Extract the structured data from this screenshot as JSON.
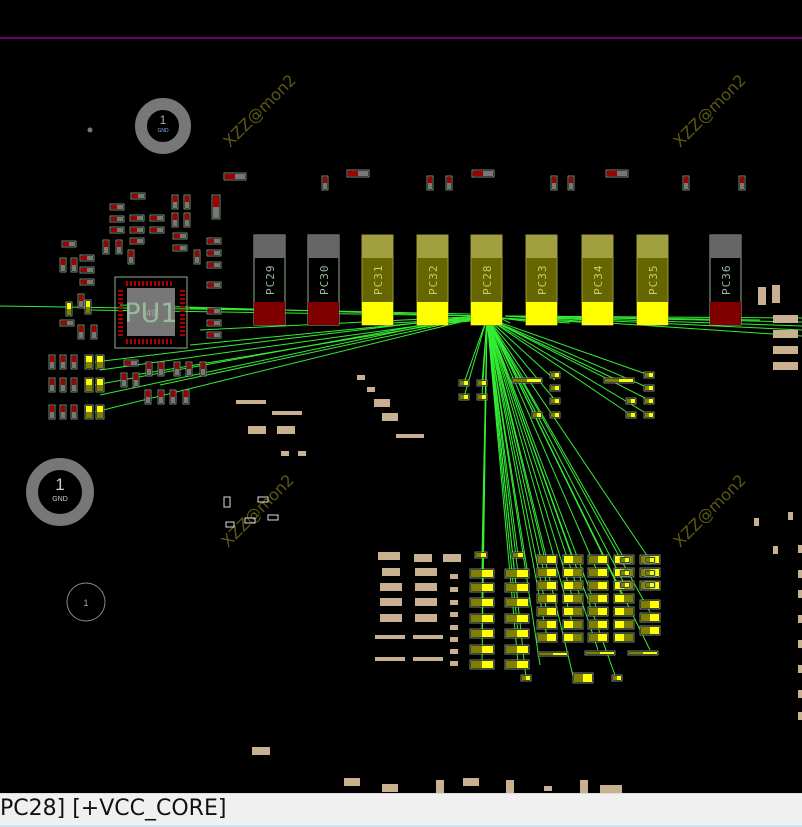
{
  "board": {
    "watermark": "XZZ@mon2",
    "ic": {
      "ref": "PU1",
      "sub": "49"
    },
    "mounting_holes": [
      {
        "pin": "1",
        "net": "GND"
      },
      {
        "pin": "1",
        "net": "GND"
      },
      {
        "pin": "1"
      }
    ],
    "capacitors": [
      {
        "ref": "PC29",
        "state": "unselected"
      },
      {
        "ref": "PC30",
        "state": "unselected"
      },
      {
        "ref": "PC31",
        "state": "highlighted"
      },
      {
        "ref": "PC32",
        "state": "highlighted"
      },
      {
        "ref": "PC28",
        "state": "selected"
      },
      {
        "ref": "PC33",
        "state": "highlighted"
      },
      {
        "ref": "PC34",
        "state": "highlighted"
      },
      {
        "ref": "PC35",
        "state": "highlighted"
      },
      {
        "ref": "PC36",
        "state": "unselected"
      }
    ],
    "colors": {
      "background": "#000000",
      "board_edge": "#e000e0",
      "ratsnest": "#33ee33",
      "highlight_pad": "#ffff00",
      "highlight_body": "#666600",
      "normal_pad": "#800000",
      "component_outline": "#8fae8f"
    }
  },
  "status_bar": {
    "text": "PC28] [+VCC_CORE]"
  }
}
